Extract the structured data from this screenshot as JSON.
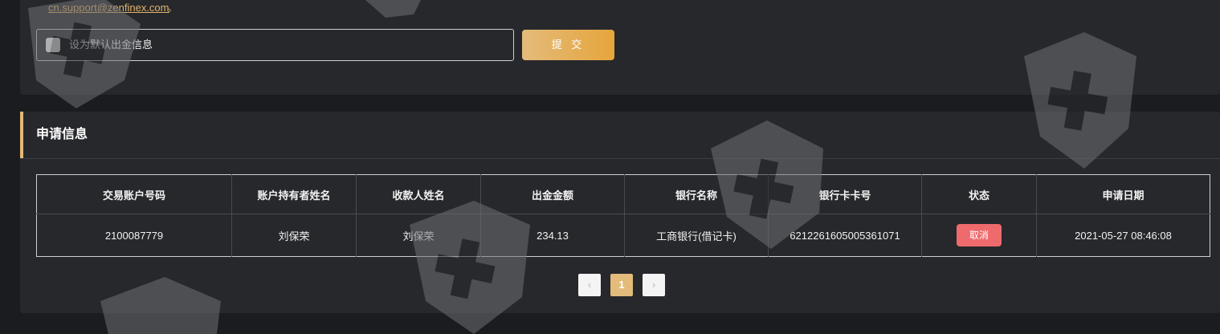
{
  "support": {
    "email": "cn.support@zenfinex.com",
    "email_tail": "。"
  },
  "withdraw_form": {
    "default_checkbox_label": "设为默认出金信息",
    "submit_label": "提 交"
  },
  "application": {
    "title": "申请信息",
    "columns": [
      "交易账户号码",
      "账户持有者姓名",
      "收款人姓名",
      "出金金额",
      "银行名称",
      "银行卡卡号",
      "状态",
      "申请日期"
    ],
    "rows": [
      {
        "account_number": "2100087779",
        "holder_name": "刘保荣",
        "payee_name": "刘保荣",
        "amount": "234.13",
        "bank_name": "工商银行(借记卡)",
        "card_number": "6212261605005361071",
        "status": "取消",
        "date": "2021-05-27 08:46:08"
      }
    ],
    "pagination": {
      "prev_icon": "‹",
      "current_page": "1",
      "next_icon": "›"
    }
  },
  "colors": {
    "accent": "#e5b877",
    "status_cancel": "#ee6a6c",
    "card_bg": "#27282c"
  }
}
